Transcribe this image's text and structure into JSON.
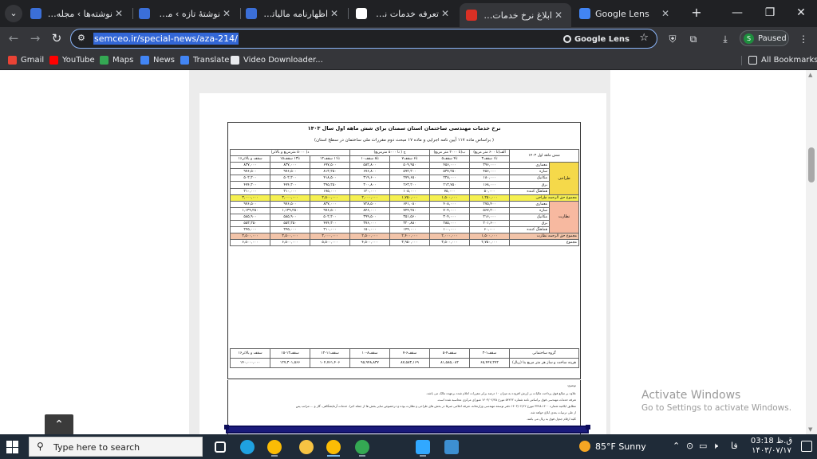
{
  "browser": {
    "tabs": [
      {
        "title": "نوشته‌ها › مجله آموزشی",
        "favicon_color": "#3b6fd8",
        "active": false
      },
      {
        "title": "نوشتهٔ تازه › مجله آموزشی",
        "favicon_color": "#3b6fd8",
        "active": false
      },
      {
        "title": "اظهارنامه مالیاتی نظام",
        "favicon_color": "#3b6fd8",
        "active": false
      },
      {
        "title": "تعرفه خدمات نظام مهندسی",
        "favicon_color": "#ffffff",
        "active": false
      },
      {
        "title": "ابلاغ نرخ خدمات مهندسی",
        "favicon_color": "#d93025",
        "active": true
      },
      {
        "title": "Google Lens",
        "favicon_color": "#4285f4",
        "active": false
      }
    ],
    "new_tab_label": "+",
    "window_controls": {
      "minimize": "—",
      "maximize": "❐",
      "close": "✕"
    },
    "url": "semceo.ir/special-news/aza-214/",
    "lens_label": "Google Lens",
    "profile": {
      "initial": "S",
      "status": "Paused"
    },
    "bookmarks": [
      {
        "label": "Gmail",
        "color": "#ea4335"
      },
      {
        "label": "YouTube",
        "color": "#ff0000"
      },
      {
        "label": "Maps",
        "color": "#34a853"
      },
      {
        "label": "News",
        "color": "#4285f4"
      },
      {
        "label": "Translate",
        "color": "#4285f4"
      },
      {
        "label": "Video Downloader...",
        "color": "#e8eaed"
      }
    ],
    "all_bookmarks_label": "All Bookmarks"
  },
  "document": {
    "title": "نرخ خدمات مهندسی ساختمان استان سمنان برای شش ماهه اول سال ۱۴۰۳",
    "subtitle": "( براساس ماده ۱۱۷ آیین نامه اجرایی و ماده ۱۷ مبحث دوم مقررات ملی ساختمان در سطح استان)",
    "header_period": "شش ماهه اول ۱۴۰۳",
    "column_groups": [
      "الف(تا ۶۰۰ متر مربع)",
      "ب(تا ۲۰۰۰ متر مربع)",
      "ج ( تا ۵۰۰۰ مترمربع)",
      "د( ۵۰۰۰ مترمربع و بالاتر)"
    ],
    "column_heads": [
      "۳تا۱ سقف",
      "۵تا۴ سقف",
      "۷تا۶ سقف",
      "۱۰تا۸ سقف",
      "۱۲تا۱۱ سقف",
      "۱۵تا۱۳ سقف",
      "۱۶سقف و بالاتر"
    ],
    "groups": [
      {
        "name": "طراحی",
        "rows": [
          {
            "label": "معماری",
            "values": [
              "۳۹۶,۰۰۰",
              "۴۵۶,۰۰۰",
              "۵۰۹,۹۵۰",
              "۵۸۲,۸۰۰",
              "۶۹۷,۵۰۰",
              "۸۳۷,۰۰۰",
              "۸۳۷,۰۰۰"
            ]
          },
          {
            "label": "سازه",
            "values": [
              "۴۵۶,۰۰۰",
              "۵۳۷,۲۵۰",
              "۵۹۲,۲۰۰",
              "۶۷۶,۸۰۰",
              "۸۱۳,۲۵۰",
              "۹۷۶,۵۰۰",
              "۹۷۶,۵۰۰"
            ]
          },
          {
            "label": "مکانیک",
            "values": [
              "۱۸۰,۰۰۰",
              "۲۲۸,۰۰۰",
              "۲۷۹,۶۵۰",
              "۳۱۹,۶۰۰",
              "۴۱۸,۵۰۰",
              "۵۰۲,۲۰۰",
              "۵۰۲,۲۰۰"
            ]
          },
          {
            "label": "برق",
            "values": [
              "۱۶۸,۰۰۰",
              "۲۱۳,۷۵۰",
              "۲۶۳,۲۰۰",
              "۳۰۰,۸۰۰",
              "۳۹۵,۲۵۰",
              "۴۷۴,۳۰۰",
              "۴۷۴,۳۰۰"
            ]
          },
          {
            "label": "هماهنگ کننده",
            "values": [
              "۵۰,۰۰۰",
              "۷۵,۰۰۰",
              "۱۰۵,۰۰۰",
              "۱۲۰,۰۰۰",
              "۱۷۵,۰۰۰",
              "۲۱۰,۰۰۰",
              "۲۱۰,۰۰۰"
            ]
          }
        ]
      },
      {
        "name": "نظارت",
        "rows": [
          {
            "label": "معماری",
            "values": [
              "۲۷۵,۴۰۰",
              "۴۰۸,۰۰۰",
              "۶۴۱,۰۸۰",
              "۷۲۸,۵۰۰",
              "۸۳۷,۰۰۰",
              "۹۷۶,۵۰۰",
              "۹۷۶,۵۰۰"
            ]
          },
          {
            "label": "سازه",
            "values": [
              "۵۶۷,۲۰۰",
              "۷۰۴,۰۰۰",
              "۷۴۴,۲۸۰",
              "۸۴۶,۰۰۰",
              "۹۷۶,۵۰۰",
              "۱,۱۳۹,۲۵۰",
              "۱,۱۳۹,۲۵۰"
            ]
          },
          {
            "label": "مکانیک",
            "values": [
              "۲۱۶,۰۰۰",
              "۳۰۴,۰۰۰",
              "۳۵۱,۵۶۰",
              "۳۹۹,۵۰۰",
              "۵۰۲,۲۰۰",
              "۵۸۵,۹۰۰",
              "۵۸۵,۹۰۰"
            ]
          },
          {
            "label": "برق",
            "values": [
              "۲۰۱,۶۰۰",
              "۲۸۵,۰۰۰",
              "۳۲۰,۸۸۰",
              "۳۷۶,۰۰۰",
              "۴۷۴,۳۰۰",
              "۵۵۳,۳۵۰",
              "۵۵۳,۳۵۰"
            ]
          },
          {
            "label": "هماهنگ کننده",
            "values": [
              "۶۰,۰۰۰",
              "۱۰۰,۰۰۰",
              "۱۴۴,۰۰۰",
              "۱۵۰,۰۰۰",
              "۲۱۰,۰۰۰",
              "۲۴۵,۰۰۰",
              "۲۴۵,۰۰۰"
            ]
          }
        ]
      }
    ],
    "sum_design": {
      "label": "مجموع حق الزحمه طراحی",
      "values": [
        "۱,۲۵۰,۰۰۰",
        "۱,۵۰۰,۰۰۰",
        "۱,۷۵۰,۰۰۰",
        "۲,۰۰۰,۰۰۰",
        "۲,۵۰۰,۰۰۰",
        "۳,۰۰۰,۰۰۰",
        "۳,۰۰۰,۰۰۰"
      ]
    },
    "sum_supervision": {
      "label": "مجموع حق الزحمه نظارت",
      "values": [
        "۱,۵۰۰,۰۰۰",
        "۲,۰۰۰,۰۰۰",
        "۲,۴۰۰,۰۰۰",
        "۲,۵۰۰,۰۰۰",
        "۳,۰۰۰,۰۰۰",
        "۳,۵۰۰,۰۰۰",
        "۳,۵۰۰,۰۰۰"
      ]
    },
    "total": {
      "label": "مجموع",
      "values": [
        "۲,۷۵۰,۰۰۰",
        "۳,۵۰۰,۰۰۰",
        "۳,۹۵۰,۰۰۰",
        "۴,۵۰۰,۰۰۰",
        "۵,۵۰۰,۰۰۰",
        "۶,۵۰۰,۰۰۰",
        "۶,۵۰۰,۰۰۰"
      ]
    },
    "cost_table": {
      "header_label": "گروه ساختمانی",
      "row_label": "هزینه ساخت و ساز هر متر مربع بنا (ریال)",
      "heads": [
        "۳-۱سقف",
        "۵-۴سقف",
        "۷-۶سقف",
        "۱۰-۸سقف",
        "۱۲-۱۱سقف",
        "۱۵-۱۳سقف",
        "۱۶سقف و بالاتر"
      ],
      "values": [
        "۶۵,۴۴۷,۲۷۲",
        "۸۱,۵۸۵,۰۸۲",
        "۸۷,۵۸۳,۱۶۹",
        "۹۵,۹۴۸,۸۳۷",
        "۱۰۴,۷۶۱,۴۰۶",
        "۱۲۷,۳۰۱,۵۶۶",
        "۱۴۰,۰۰۰,۰۰۰"
      ]
    },
    "notes_heading": "توضیح:",
    "notes": [
      "علاوه بر مبالغ فوق پرداخت مالیات بر ارزش افزوده به میزان ۱۰ درصد برابر مقررات اعلام شده برعهده مالک می باشد.",
      "تعرفه خدمات مهندسی فوق براساس نامه شماره ۵۴۲۲۲ مورخ ۱۴۰۳/۰۲/۲۵ شورای مرکزی محاسبه شده است.",
      "مطابق ابلاغیه شماره ۱۴۰۰-۳۴۹۸ مورخ ۱۴۰۳/۰۲/۲۲ دفتر توسعه مهندسی وزارتخانه، تعرفه اعلامی صرفا در بخش های طراحی و نظارت بوده و درخصوص سایر بخش ها از جمله اجرا، خدمات آزمایشگاهی، گاز و ... مراتب پس",
      "از طی ترتیبات بعدی ابلاغ خواهد شد.",
      "کلیه ارقام جدول فوق به ریال می باشد."
    ]
  },
  "overlay": {
    "activate_line1": "Activate Windows",
    "activate_line2": "Go to Settings to activate Windows."
  },
  "taskbar": {
    "search_placeholder": "Type here to search",
    "apps": [
      {
        "name": "task-view",
        "color": "#ffffff"
      },
      {
        "name": "edge",
        "color": "#1fa1e0"
      },
      {
        "name": "chrome",
        "color": "#fbbc05"
      },
      {
        "name": "file-explorer",
        "color": "#f6c343"
      },
      {
        "name": "chrome-active",
        "color": "#fbbc05"
      },
      {
        "name": "chrome-profile",
        "color": "#34a853"
      },
      {
        "name": "photoshop",
        "color": "#31a8ff"
      },
      {
        "name": "paint",
        "color": "#3d8fd1"
      }
    ],
    "weather_temp": "85°F",
    "weather_desc": "Sunny",
    "lang": "فا",
    "time": "03:18 ق.ظ",
    "date": "۱۴۰۳/۰۷/۱۷"
  }
}
